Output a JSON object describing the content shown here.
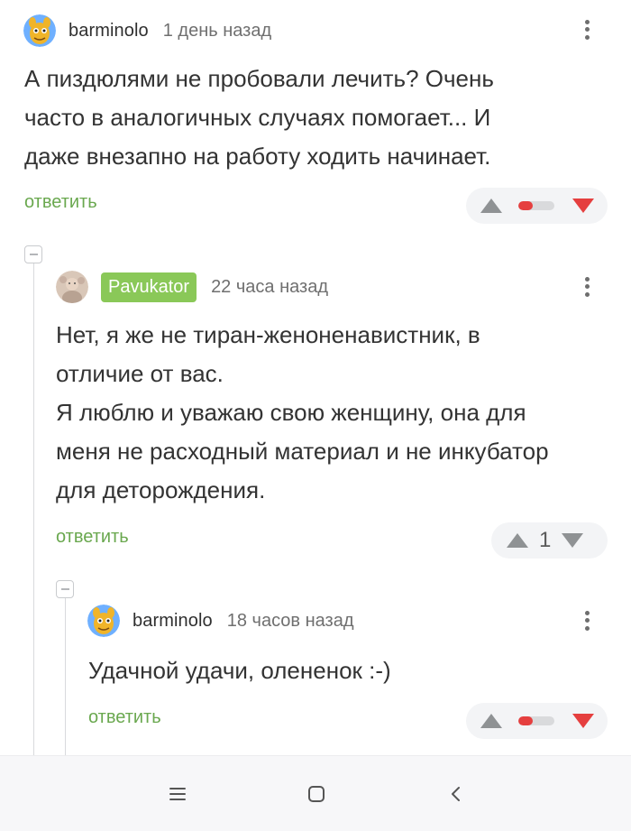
{
  "comments": [
    {
      "username": "barminolo",
      "time": "1 день назад",
      "text": [
        "А пиздюлями не пробовали лечить? Очень",
        "часто в аналогичных случаях помогает... И",
        "даже внезапно на работу ходить начинает."
      ],
      "reply_label": "ответить",
      "vote_ratio": 0.4
    },
    {
      "username": "Pavukator",
      "time": "22 часа назад",
      "text": [
        "Нет, я же не тиран-женоненавистник, в",
        "отличие от вас.",
        "Я люблю и уважаю свою женщину, она для",
        "меня не расходный материал и не инкубатор",
        "для деторождения."
      ],
      "reply_label": "ответить",
      "score": "1"
    },
    {
      "username": "barminolo",
      "time": "18 часов назад",
      "text": [
        "Удачной удачи, олененок :-)"
      ],
      "reply_label": "ответить",
      "vote_ratio": 0.4
    }
  ],
  "navbar": {
    "icons": [
      "menu-icon",
      "home-icon",
      "back-icon"
    ]
  }
}
